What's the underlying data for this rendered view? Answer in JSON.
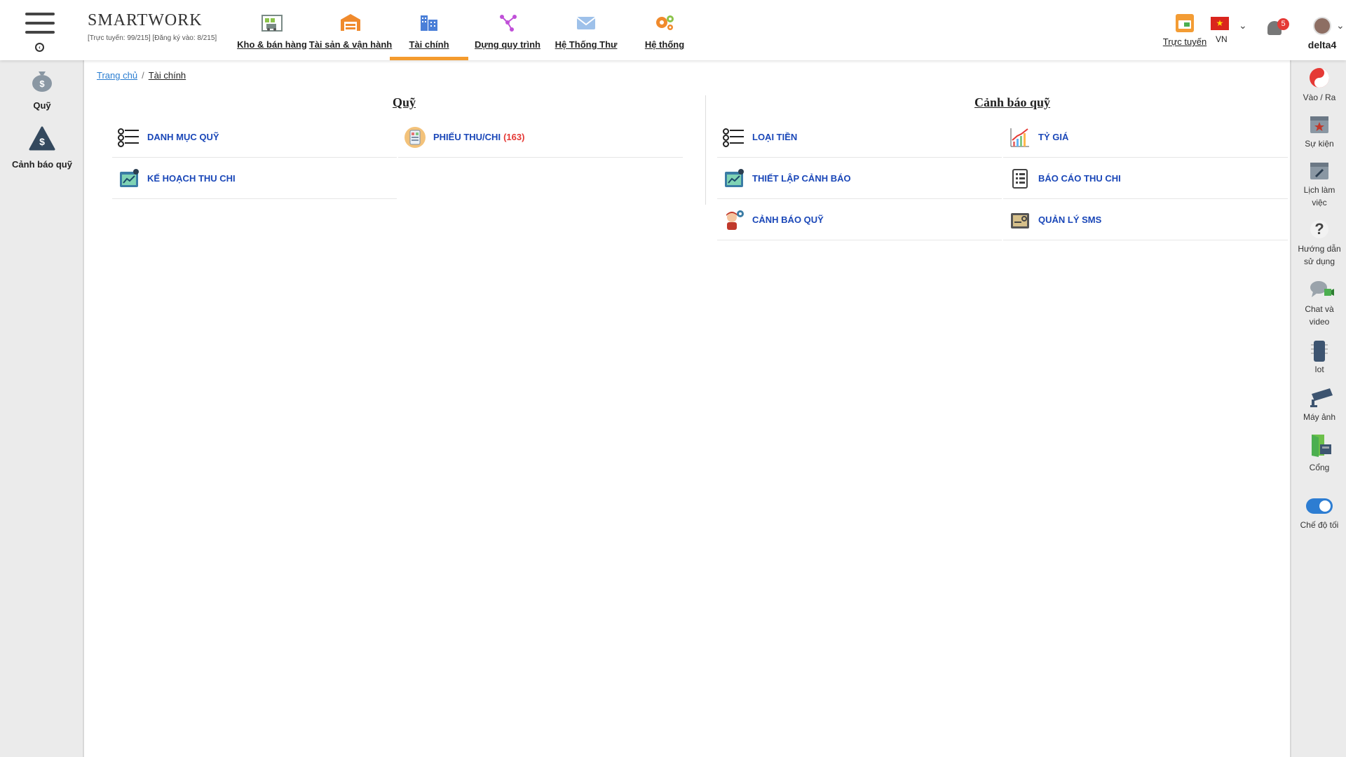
{
  "app": {
    "brand": "SMARTWORK",
    "subtitle": "[Trực tuyến: 99/215] [Đăng ký vào: 8/215]"
  },
  "modules": [
    {
      "label": "Kho & bán hàng",
      "icon": "warehouse-icon"
    },
    {
      "label": "Tài sản & vận hành",
      "icon": "garage-icon"
    },
    {
      "label": "Tài chính",
      "icon": "building-icon",
      "active": true
    },
    {
      "label": "Dựng quy trình",
      "icon": "workflow-icon"
    },
    {
      "label": "Hệ Thống Thư",
      "icon": "mail-icon"
    },
    {
      "label": "Hệ thống",
      "icon": "gears-icon"
    }
  ],
  "top_right": {
    "online_label": "Trực tuyến",
    "language": "VN",
    "notification_count": "5",
    "username": "delta4"
  },
  "left_sidebar": [
    {
      "label": "Quỹ",
      "icon": "money-bag-icon"
    },
    {
      "label": "Cảnh báo quỹ",
      "icon": "money-warning-icon"
    }
  ],
  "right_sidebar": [
    {
      "label": "Vào / Ra",
      "icon": "yin-yang-icon"
    },
    {
      "label": "Sự kiện",
      "icon": "event-calendar-icon"
    },
    {
      "label": "Lịch làm việc",
      "icon": "work-calendar-icon"
    },
    {
      "label": "Hướng dẫn sử dụng",
      "icon": "help-icon"
    },
    {
      "label": "Chat và video",
      "icon": "chat-video-icon"
    },
    {
      "label": "Iot",
      "icon": "iot-icon"
    },
    {
      "label": "Máy ảnh",
      "icon": "camera-icon"
    },
    {
      "label": "Cổng",
      "icon": "gate-icon"
    },
    {
      "label": "Chế độ tối",
      "icon": "dark-mode-toggle-icon"
    }
  ],
  "breadcrumb": {
    "home": "Trang chủ",
    "separator": "/",
    "current": "Tài chính"
  },
  "panels": {
    "fund": {
      "title": "Quỹ",
      "tiles": [
        {
          "label": "DANH MỤC QUỸ",
          "icon": "list-icon"
        },
        {
          "label": "PHIẾU THU/CHI",
          "count": "(163)",
          "icon": "receipt-icon"
        },
        {
          "label": "KẾ HOẠCH THU CHI",
          "icon": "plan-icon"
        }
      ]
    },
    "fund_warning": {
      "title": "Cảnh báo quỹ",
      "tiles": [
        {
          "label": "LOẠI TIỀN",
          "icon": "list-icon"
        },
        {
          "label": "TỶ GIÁ",
          "icon": "exchange-rate-chart-icon"
        },
        {
          "label": "THIẾT LẬP CẢNH BÁO",
          "icon": "alert-settings-icon"
        },
        {
          "label": "BÁO CÁO THU CHI",
          "icon": "report-icon"
        },
        {
          "label": "CẢNH BÁO QUỸ",
          "icon": "fund-alert-icon"
        },
        {
          "label": "QUẢN LÝ SMS",
          "icon": "sms-manage-icon"
        }
      ]
    }
  },
  "colors": {
    "accent": "#f49b2e",
    "link": "#1a47b8",
    "count": "#e53935",
    "sidebar_bg": "#ebebeb"
  }
}
